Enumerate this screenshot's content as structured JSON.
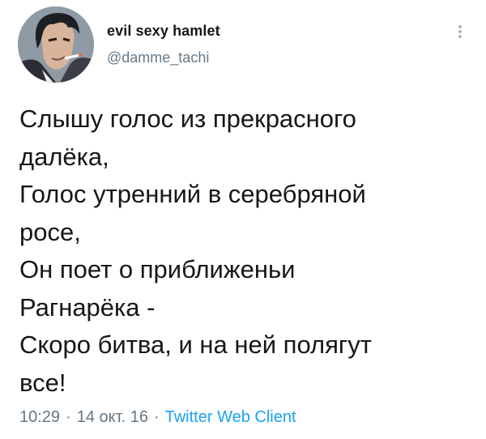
{
  "author": {
    "display_name": "evil sexy hamlet",
    "handle": "@damme_tachi"
  },
  "tweet": {
    "lines": [
      "Слышу голос из прекрасного",
      "далёка,",
      "Голос утренний в серебряной",
      "росе,",
      "Он поет о приближеньи",
      "Рагнарёка -",
      "Скоро битва, и на ней полягут",
      "все!"
    ]
  },
  "meta": {
    "time": "10:29",
    "separator": "·",
    "date": "14 окт. 16",
    "source": "Twitter Web Client"
  },
  "icons": {
    "more": "more-vertical-icon"
  },
  "colors": {
    "text": "#14171a",
    "secondary": "#657786",
    "link": "#1da1f2"
  }
}
